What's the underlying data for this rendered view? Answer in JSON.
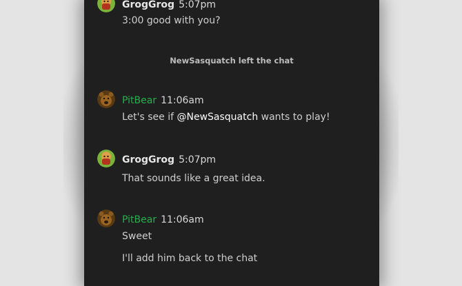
{
  "messages": [
    {
      "author": "GrogGrog",
      "time": "5:07pm",
      "text": "3:00 good with you?"
    },
    {
      "author": "PitBear",
      "time": "11:06am",
      "text_before": "Let's see if",
      "mention": "@NewSasquatch",
      "text_after": "wants to play!"
    },
    {
      "author": "GrogGrog",
      "time": "5:07pm",
      "text": "That sounds like a great idea."
    },
    {
      "author": "PitBear",
      "time": "11:06am",
      "lines": [
        "Sweet",
        "I'll add him back to the chat"
      ]
    }
  ],
  "system_notice": "NewSasquatch left the chat",
  "colors": {
    "panel_bg": "#1f1f1f",
    "page_bg": "#e4e4e4",
    "pitbear_name": "#23b14d",
    "text": "#cfcfcf"
  },
  "icons": {
    "groggrog_avatar": "dwarf-avatar-icon",
    "pitbear_avatar": "bear-avatar-icon"
  }
}
